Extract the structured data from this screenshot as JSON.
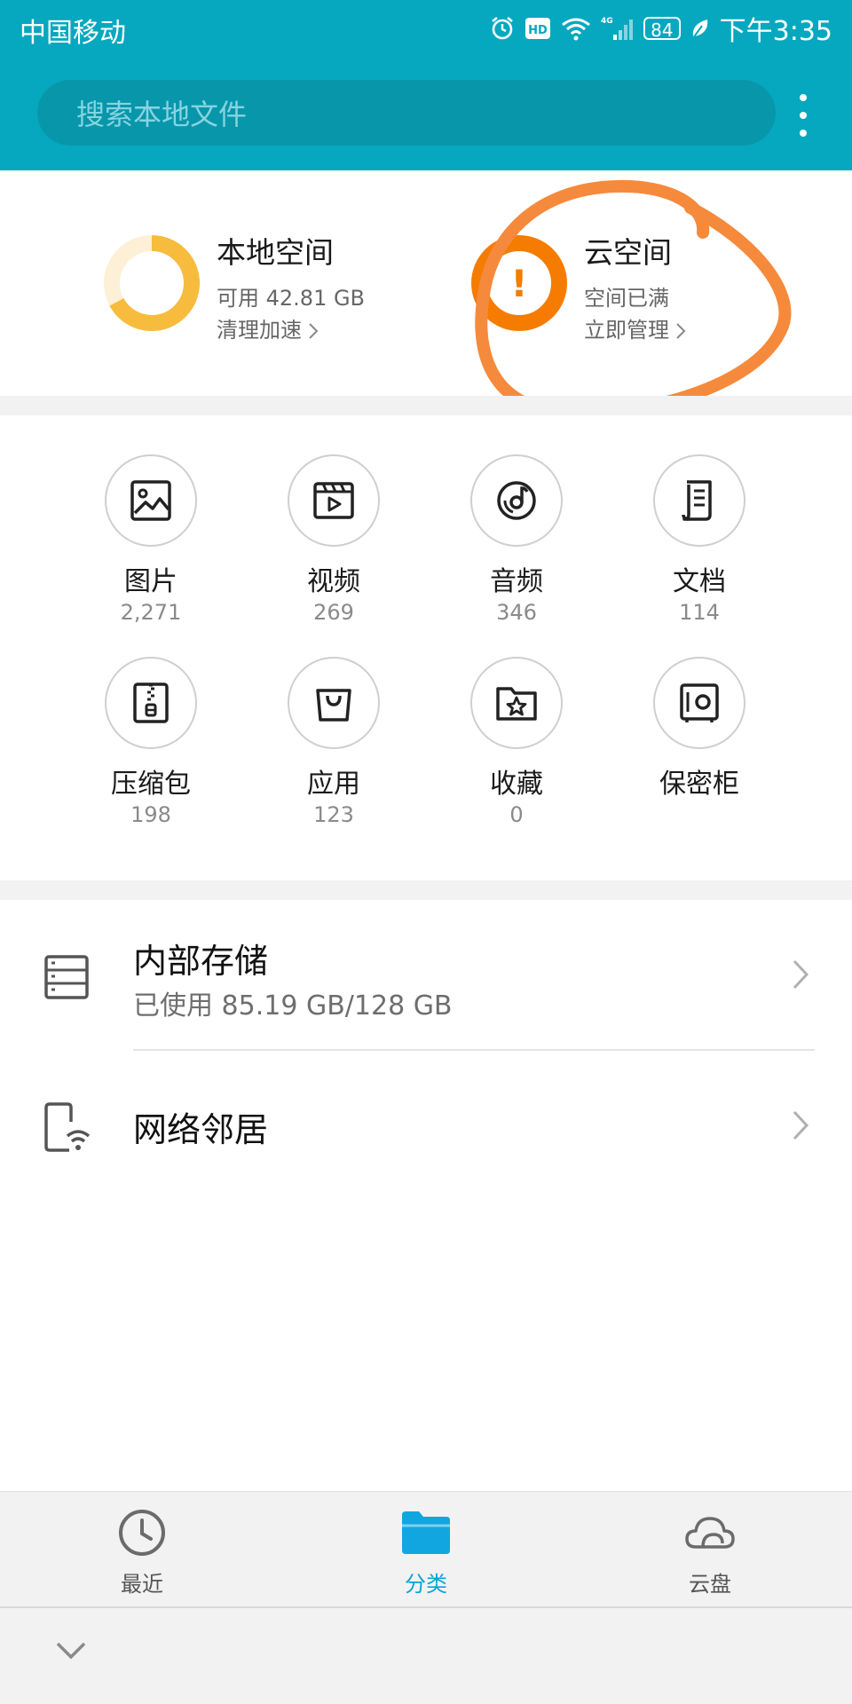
{
  "status_bar": {
    "carrier": "中国移动",
    "network": "4G",
    "battery": "84",
    "time": "下午3:35"
  },
  "search": {
    "placeholder": "搜索本地文件"
  },
  "storage": {
    "local": {
      "title": "本地空间",
      "available": "可用 42.81 GB",
      "action": "清理加速",
      "used_fraction": 0.67
    },
    "cloud": {
      "title": "云空间",
      "status": "空间已满",
      "action": "立即管理",
      "alert": "!"
    }
  },
  "categories": [
    {
      "label": "图片",
      "count": "2,271",
      "icon": "image-icon"
    },
    {
      "label": "视频",
      "count": "269",
      "icon": "video-icon"
    },
    {
      "label": "音频",
      "count": "346",
      "icon": "audio-icon"
    },
    {
      "label": "文档",
      "count": "114",
      "icon": "document-icon"
    },
    {
      "label": "压缩包",
      "count": "198",
      "icon": "zip-icon"
    },
    {
      "label": "应用",
      "count": "123",
      "icon": "app-bag-icon"
    },
    {
      "label": "收藏",
      "count": "0",
      "icon": "favorite-folder-icon"
    },
    {
      "label": "保密柜",
      "count": "",
      "icon": "safe-icon"
    }
  ],
  "locations": {
    "internal": {
      "title": "内部存储",
      "usage": "已使用 85.19 GB/128 GB"
    },
    "network": {
      "title": "网络邻居"
    }
  },
  "tabs": [
    {
      "label": "最近",
      "icon": "clock-icon",
      "active": false
    },
    {
      "label": "分类",
      "icon": "folder-icon",
      "active": true
    },
    {
      "label": "云盘",
      "icon": "cloud-icon",
      "active": false
    }
  ],
  "colors": {
    "header": "#06a8bf",
    "accent": "#0aa3d6",
    "local_ring": "#f7bb3e",
    "cloud_ring": "#f57c00",
    "annotation": "#f58a3c"
  }
}
